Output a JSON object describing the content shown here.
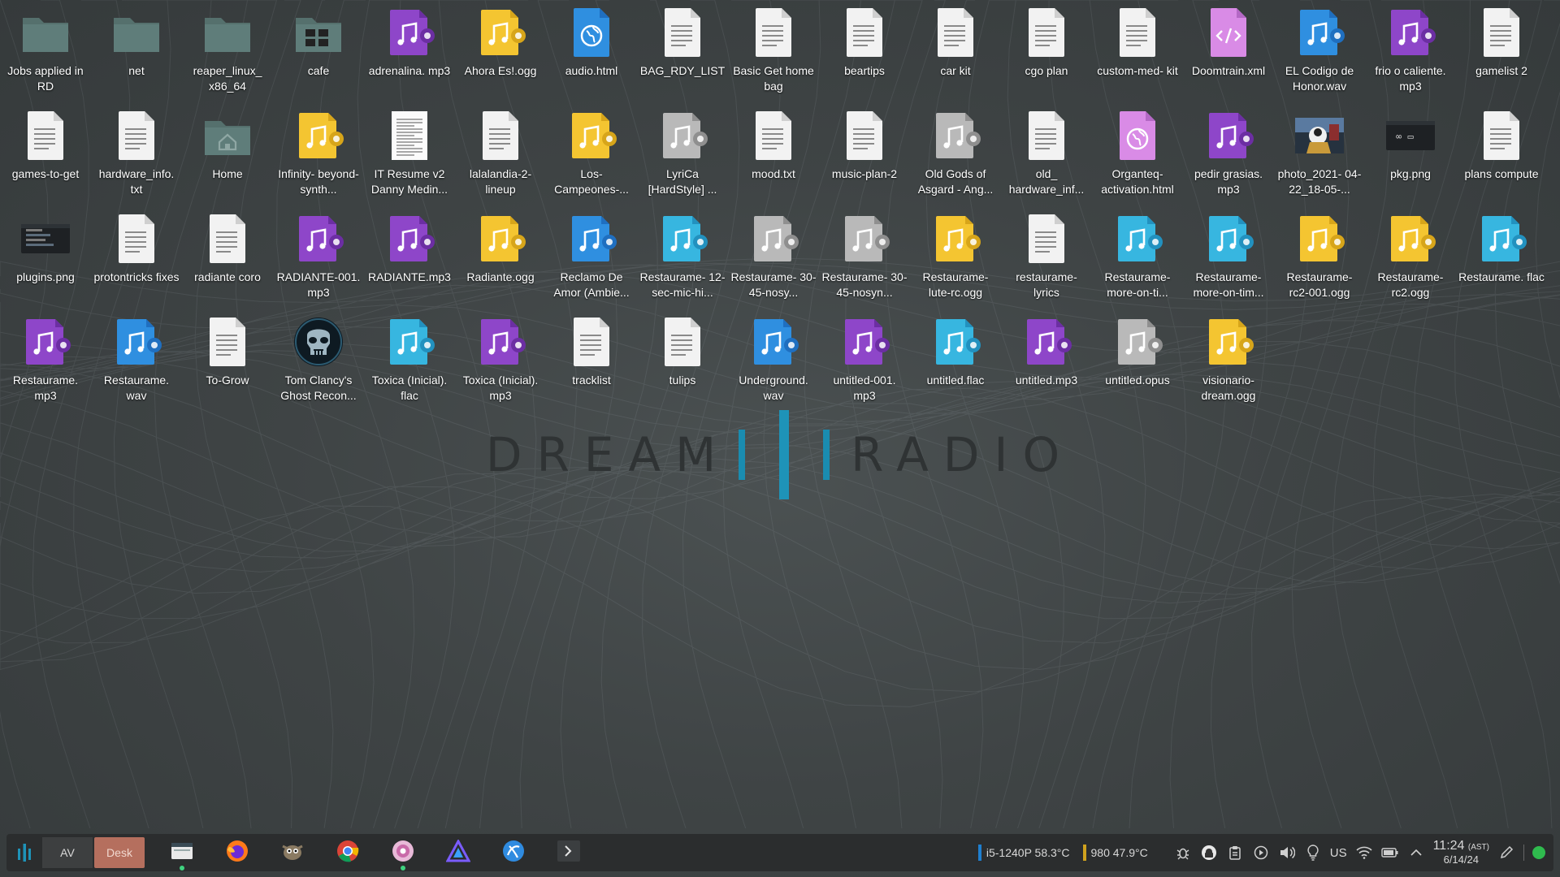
{
  "wallpaper": {
    "brand_left": "DREAM",
    "brand_right": "RADIO",
    "accent": "#1e93b8"
  },
  "desktop": {
    "icons": [
      {
        "label": "Jobs applied in RD",
        "type": "folder"
      },
      {
        "label": "net",
        "type": "folder"
      },
      {
        "label": "reaper_linux_ x86_64",
        "type": "folder"
      },
      {
        "label": "cafe",
        "type": "folder-image"
      },
      {
        "label": "adrenalina. mp3",
        "type": "audio-purple"
      },
      {
        "label": "Ahora Es!.ogg",
        "type": "audio-yellow"
      },
      {
        "label": "audio.html",
        "type": "html-blue"
      },
      {
        "label": "BAG_RDY_LIST",
        "type": "text"
      },
      {
        "label": "Basic Get home bag",
        "type": "text"
      },
      {
        "label": "beartips",
        "type": "text"
      },
      {
        "label": "car kit",
        "type": "text"
      },
      {
        "label": "cgo plan",
        "type": "text"
      },
      {
        "label": "custom-med- kit",
        "type": "text"
      },
      {
        "label": "Doomtrain.xml",
        "type": "xml"
      },
      {
        "label": "EL Codigo de Honor.wav",
        "type": "audio-blue"
      },
      {
        "label": "frio o caliente. mp3",
        "type": "audio-purple"
      },
      {
        "label": "gamelist 2",
        "type": "text"
      },
      {
        "label": "games-to-get",
        "type": "text"
      },
      {
        "label": "hardware_info. txt",
        "type": "text"
      },
      {
        "label": "Home",
        "type": "folder-home"
      },
      {
        "label": "Infinity- beyond-synth...",
        "type": "audio-yellow"
      },
      {
        "label": "IT Resume v2 Danny Medin...",
        "type": "document"
      },
      {
        "label": "lalalandia-2- lineup",
        "type": "text"
      },
      {
        "label": "Los- Campeones-...",
        "type": "audio-yellow"
      },
      {
        "label": "LyriCa [HardStyle] ...",
        "type": "audio-gray"
      },
      {
        "label": "mood.txt",
        "type": "text"
      },
      {
        "label": "music-plan-2",
        "type": "text"
      },
      {
        "label": "Old Gods of Asgard - Ang...",
        "type": "audio-gray"
      },
      {
        "label": "old_ hardware_inf...",
        "type": "text"
      },
      {
        "label": "Organteq- activation.html",
        "type": "html-pink"
      },
      {
        "label": "pedir grasias. mp3",
        "type": "audio-purple"
      },
      {
        "label": "photo_2021- 04-22_18-05-...",
        "type": "photo"
      },
      {
        "label": "pkg.png",
        "type": "image-dark"
      },
      {
        "label": "plans compute",
        "type": "text"
      },
      {
        "label": "plugins.png",
        "type": "image-dark"
      },
      {
        "label": "protontricks fixes",
        "type": "text"
      },
      {
        "label": "radiante coro",
        "type": "text"
      },
      {
        "label": "RADIANTE-001. mp3",
        "type": "audio-purple"
      },
      {
        "label": "RADIANTE.mp3",
        "type": "audio-purple"
      },
      {
        "label": "Radiante.ogg",
        "type": "audio-yellow"
      },
      {
        "label": "Reclamo De Amor (Ambie...",
        "type": "audio-blue"
      },
      {
        "label": "Restaurame- 12-sec-mic-hi...",
        "type": "audio-cyan"
      },
      {
        "label": "Restaurame- 30-45-nosy...",
        "type": "audio-gray"
      },
      {
        "label": "Restaurame- 30-45-nosyn...",
        "type": "audio-gray"
      },
      {
        "label": "Restaurame- lute-rc.ogg",
        "type": "audio-yellow"
      },
      {
        "label": "restaurame- lyrics",
        "type": "text"
      },
      {
        "label": "Restaurame- more-on-ti...",
        "type": "audio-cyan"
      },
      {
        "label": "Restaurame- more-on-tim...",
        "type": "audio-cyan"
      },
      {
        "label": "Restaurame- rc2-001.ogg",
        "type": "audio-yellow"
      },
      {
        "label": "Restaurame- rc2.ogg",
        "type": "audio-yellow"
      },
      {
        "label": "Restaurame. flac",
        "type": "audio-cyan"
      },
      {
        "label": "Restaurame. mp3",
        "type": "audio-purple"
      },
      {
        "label": "Restaurame. wav",
        "type": "audio-blue"
      },
      {
        "label": "To-Grow",
        "type": "text"
      },
      {
        "label": "Tom Clancy's Ghost Recon...",
        "type": "game"
      },
      {
        "label": "Toxica (Inicial). flac",
        "type": "audio-cyan"
      },
      {
        "label": "Toxica (Inicial). mp3",
        "type": "audio-purple"
      },
      {
        "label": "tracklist",
        "type": "text"
      },
      {
        "label": "tulips",
        "type": "text"
      },
      {
        "label": "Underground. wav",
        "type": "audio-blue"
      },
      {
        "label": "untitled-001. mp3",
        "type": "audio-purple"
      },
      {
        "label": "untitled.flac",
        "type": "audio-cyan"
      },
      {
        "label": "untitled.mp3",
        "type": "audio-purple"
      },
      {
        "label": "untitled.opus",
        "type": "audio-gray"
      },
      {
        "label": "visionario- dream.ogg",
        "type": "audio-yellow"
      }
    ]
  },
  "taskbar": {
    "launcher_icon": "app-launcher-icon",
    "virtual_desktops": [
      {
        "label": "AV",
        "active": false
      },
      {
        "label": "Desk",
        "active": true
      }
    ],
    "apps": [
      {
        "name": "file-manager-icon",
        "running": true
      },
      {
        "name": "firefox-icon",
        "running": false
      },
      {
        "name": "gimp-icon",
        "running": false
      },
      {
        "name": "chrome-icon",
        "running": false
      },
      {
        "name": "pink-app-icon",
        "running": true
      },
      {
        "name": "triangle-app-icon",
        "running": false
      },
      {
        "name": "blue-app-icon",
        "running": false
      },
      {
        "name": "terminal-icon",
        "running": false
      }
    ],
    "cpu": {
      "label": "i5-1240P 58.3°C",
      "color": "#1e7fd0"
    },
    "gpu": {
      "label": "980 47.9°C",
      "color": "#d0a21e"
    },
    "keyboard_layout": "us",
    "clock": {
      "time": "11:24",
      "tz": "(AST)",
      "date": "6/14/24"
    },
    "tray": [
      "bug-icon",
      "vpn-icon",
      "clipboard-icon",
      "media-play-icon",
      "volume-icon",
      "lightbulb-icon",
      "wifi-icon",
      "battery-icon",
      "expand-tray-icon",
      "pen-icon",
      "status-icon"
    ]
  }
}
